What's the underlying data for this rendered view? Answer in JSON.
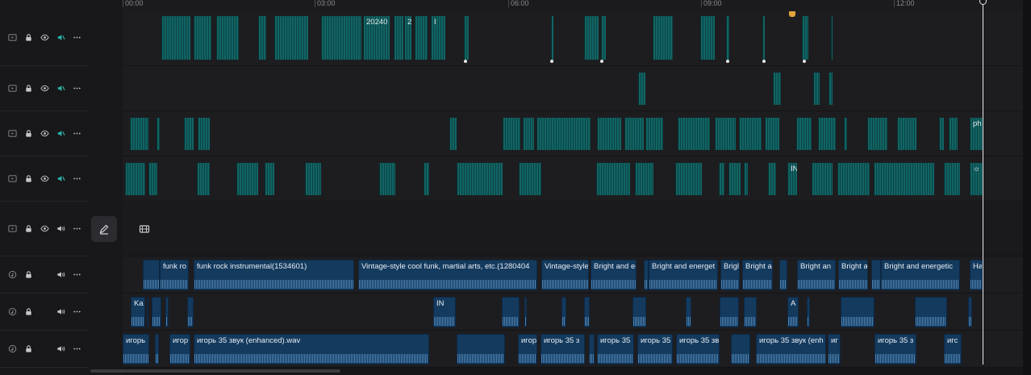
{
  "ruler": {
    "ticks": [
      "00:00",
      "03:00",
      "06:00",
      "09:00",
      "12:00"
    ]
  },
  "icons": {
    "video_track": "film-icon",
    "audio_track": "music-note-icon",
    "lock": "lock-icon",
    "visibility": "eye-icon",
    "audio": "speaker-icon",
    "more": "more-icon",
    "edit": "pencil-icon",
    "cover": "film-strip-icon"
  },
  "colors": {
    "video_clip": "#0f5a5a",
    "audio_clip": "#143a5e",
    "playhead": "#e9e9ec",
    "marker": "#e3a43a"
  },
  "timeline": {
    "tracks": [
      {
        "kind": "video",
        "clips": [
          {
            "s": 200,
            "e": 236
          },
          {
            "s": 240,
            "e": 262
          },
          {
            "s": 268,
            "e": 296
          },
          {
            "s": 320,
            "e": 330
          },
          {
            "s": 340,
            "e": 382
          },
          {
            "s": 398,
            "e": 448
          },
          {
            "s": 450,
            "e": 483,
            "label": "20240"
          },
          {
            "s": 488,
            "e": 500
          },
          {
            "s": 501,
            "e": 510,
            "label": "2"
          },
          {
            "s": 514,
            "e": 530
          },
          {
            "s": 534,
            "e": 552,
            "label": "I"
          },
          {
            "s": 575,
            "e": 581
          },
          {
            "s": 683,
            "e": 686
          },
          {
            "s": 724,
            "e": 742
          },
          {
            "s": 745,
            "e": 751
          },
          {
            "s": 809,
            "e": 834
          },
          {
            "s": 868,
            "e": 886
          },
          {
            "s": 900,
            "e": 904
          },
          {
            "s": 945,
            "e": 948
          },
          {
            "s": 994,
            "e": 1002
          },
          {
            "s": 1030,
            "e": 1032
          }
        ]
      },
      {
        "kind": "video",
        "clips": [
          {
            "s": 791,
            "e": 800
          },
          {
            "s": 958,
            "e": 968
          },
          {
            "s": 1008,
            "e": 1016
          },
          {
            "s": 1027,
            "e": 1032
          }
        ]
      },
      {
        "kind": "video",
        "clips": [
          {
            "s": 161,
            "e": 184
          },
          {
            "s": 194,
            "e": 198
          },
          {
            "s": 228,
            "e": 240
          },
          {
            "s": 245,
            "e": 260
          },
          {
            "s": 557,
            "e": 566
          },
          {
            "s": 623,
            "e": 645
          },
          {
            "s": 648,
            "e": 662
          },
          {
            "s": 665,
            "e": 732
          },
          {
            "s": 740,
            "e": 770
          },
          {
            "s": 774,
            "e": 798
          },
          {
            "s": 800,
            "e": 822
          },
          {
            "s": 840,
            "e": 880
          },
          {
            "s": 886,
            "e": 912
          },
          {
            "s": 916,
            "e": 944
          },
          {
            "s": 948,
            "e": 966
          },
          {
            "s": 987,
            "e": 1006
          },
          {
            "s": 1014,
            "e": 1036
          },
          {
            "s": 1046,
            "e": 1050
          },
          {
            "s": 1075,
            "e": 1100
          },
          {
            "s": 1112,
            "e": 1136
          },
          {
            "s": 1164,
            "e": 1170
          },
          {
            "s": 1176,
            "e": 1187
          },
          {
            "s": 1202,
            "e": 1218,
            "label": "ph"
          }
        ]
      },
      {
        "kind": "video",
        "clips": [
          {
            "s": 155,
            "e": 180
          },
          {
            "s": 184,
            "e": 195
          },
          {
            "s": 244,
            "e": 260
          },
          {
            "s": 293,
            "e": 320
          },
          {
            "s": 328,
            "e": 340
          },
          {
            "s": 378,
            "e": 398
          },
          {
            "s": 470,
            "e": 490
          },
          {
            "s": 525,
            "e": 532
          },
          {
            "s": 566,
            "e": 623
          },
          {
            "s": 643,
            "e": 671
          },
          {
            "s": 739,
            "e": 781
          },
          {
            "s": 787,
            "e": 810
          },
          {
            "s": 837,
            "e": 870
          },
          {
            "s": 891,
            "e": 898
          },
          {
            "s": 903,
            "e": 918
          },
          {
            "s": 922,
            "e": 927
          },
          {
            "s": 952,
            "e": 962
          },
          {
            "s": 976,
            "e": 988,
            "label": "IN"
          },
          {
            "s": 1006,
            "e": 1032
          },
          {
            "s": 1038,
            "e": 1078
          },
          {
            "s": 1083,
            "e": 1158
          },
          {
            "s": 1170,
            "e": 1190
          },
          {
            "s": 1202,
            "e": 1218,
            "label": "☼"
          }
        ]
      },
      {
        "kind": "cover",
        "clips": []
      },
      {
        "kind": "audio",
        "clips": [
          {
            "s": 177,
            "e": 198
          },
          {
            "s": 198,
            "e": 234,
            "label": "funk ro"
          },
          {
            "s": 240,
            "e": 439,
            "label": "funk rock instrumental(1534601)"
          },
          {
            "s": 444,
            "e": 666,
            "label": "Vintage-style cool funk, martial arts, etc.(1280404"
          },
          {
            "s": 671,
            "e": 730,
            "label": "Vintage-style"
          },
          {
            "s": 732,
            "e": 789,
            "label": "Bright and er"
          },
          {
            "s": 798,
            "e": 804
          },
          {
            "s": 804,
            "e": 890,
            "label": "Bright and energet"
          },
          {
            "s": 893,
            "e": 917,
            "label": "Brigl"
          },
          {
            "s": 920,
            "e": 958,
            "label": "Bright a"
          },
          {
            "s": 966,
            "e": 976
          },
          {
            "s": 988,
            "e": 1036,
            "label": "Bright an"
          },
          {
            "s": 1039,
            "e": 1076,
            "label": "Bright a"
          },
          {
            "s": 1080,
            "e": 1092
          },
          {
            "s": 1092,
            "e": 1190,
            "label": "Bright and energetic"
          },
          {
            "s": 1202,
            "e": 1218,
            "label": "Ha"
          }
        ]
      },
      {
        "kind": "audio",
        "clips": [
          {
            "s": 162,
            "e": 180,
            "label": "Ka"
          },
          {
            "s": 182,
            "e": 184
          },
          {
            "s": 188,
            "e": 200
          },
          {
            "s": 205,
            "e": 209
          },
          {
            "s": 232,
            "e": 240
          },
          {
            "s": 537,
            "e": 565,
            "label": "IN"
          },
          {
            "s": 622,
            "e": 644
          },
          {
            "s": 650,
            "e": 653
          },
          {
            "s": 696,
            "e": 702
          },
          {
            "s": 724,
            "e": 731
          },
          {
            "s": 784,
            "e": 801
          },
          {
            "s": 850,
            "e": 857
          },
          {
            "s": 892,
            "e": 916
          },
          {
            "s": 922,
            "e": 938
          },
          {
            "s": 976,
            "e": 990,
            "label": "A"
          },
          {
            "s": 1000,
            "e": 1004
          },
          {
            "s": 1042,
            "e": 1084
          },
          {
            "s": 1134,
            "e": 1174
          },
          {
            "s": 1200,
            "e": 1205
          }
        ]
      },
      {
        "kind": "audio",
        "clips": [
          {
            "s": 152,
            "e": 185,
            "label": "игорь"
          },
          {
            "s": 192,
            "e": 197
          },
          {
            "s": 210,
            "e": 236,
            "label": "игор"
          },
          {
            "s": 240,
            "e": 532,
            "label": "игорь 35 звук (enhanced).wav"
          },
          {
            "s": 566,
            "e": 626
          },
          {
            "s": 642,
            "e": 666,
            "label": "игор"
          },
          {
            "s": 670,
            "e": 725,
            "label": "игорь 35 з"
          },
          {
            "s": 730,
            "e": 737
          },
          {
            "s": 740,
            "e": 786,
            "label": "игорь 35"
          },
          {
            "s": 790,
            "e": 834,
            "label": "игорь 35"
          },
          {
            "s": 838,
            "e": 892,
            "label": "игорь 35 зв"
          },
          {
            "s": 906,
            "e": 930
          },
          {
            "s": 937,
            "e": 1024,
            "label": "игорь 35 звук (enh"
          },
          {
            "s": 1026,
            "e": 1042,
            "label": "иг"
          },
          {
            "s": 1084,
            "e": 1136,
            "label": "игорь 35 з"
          },
          {
            "s": 1170,
            "e": 1192,
            "label": "игс"
          }
        ]
      }
    ]
  }
}
